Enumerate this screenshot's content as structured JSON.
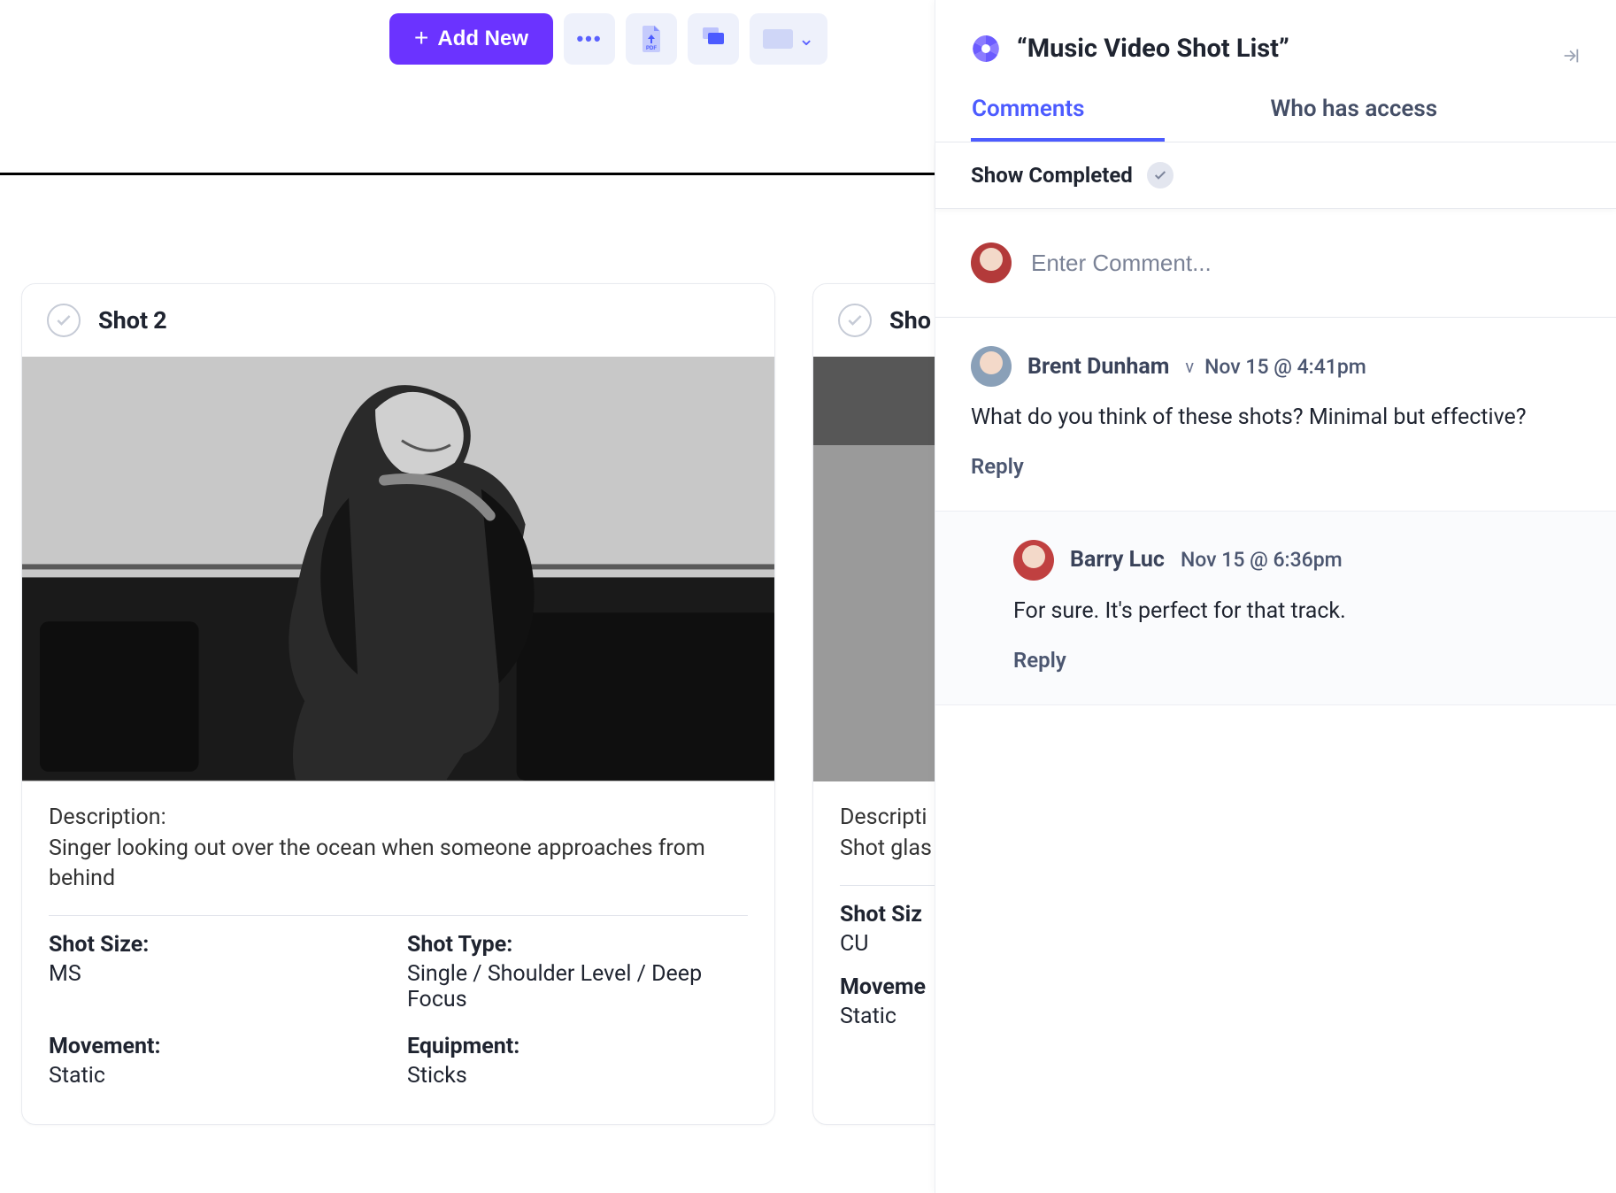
{
  "toolbar": {
    "add_new": "Add New"
  },
  "shots": [
    {
      "title_prefix": "Shot",
      "number": "2",
      "description_label": "Description:",
      "description": "Singer looking out over the ocean when someone approaches from behind",
      "fields": {
        "shot_size_label": "Shot Size:",
        "shot_size": "MS",
        "shot_type_label": "Shot Type:",
        "shot_type": "Single / Shoulder Level / Deep Focus",
        "movement_label": "Movement:",
        "movement": "Static",
        "equipment_label": "Equipment:",
        "equipment": "Sticks"
      }
    },
    {
      "title_prefix": "Sho",
      "number": "",
      "description_label": "Descripti",
      "description": "Shot glas",
      "fields": {
        "shot_size_label": "Shot Siz",
        "shot_size": "CU",
        "movement_label": "Moveme",
        "movement": "Static"
      }
    }
  ],
  "panel": {
    "title": "“Music Video Shot List”",
    "tabs": {
      "comments": "Comments",
      "access": "Who has access"
    },
    "show_completed": "Show Completed",
    "composer_placeholder": "Enter Comment...",
    "comments": [
      {
        "author": "Brent Dunham",
        "version_marker": "v",
        "time": "Nov 15 @ 4:41pm",
        "body": "What do you think of these shots? Minimal but effective?",
        "reply_label": "Reply"
      },
      {
        "author": "Barry Luc",
        "time": "Nov 15 @ 6:36pm",
        "body": "For sure. It's perfect for that track.",
        "reply_label": "Reply"
      }
    ]
  }
}
